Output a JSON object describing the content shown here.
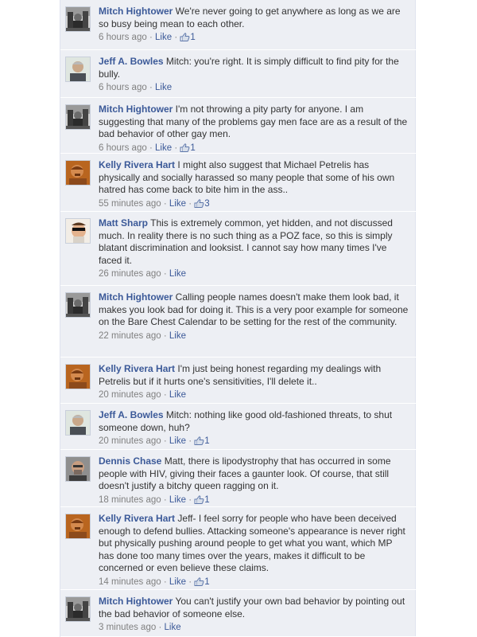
{
  "ui": {
    "like_label": "Like",
    "separator": "·"
  },
  "comments": [
    {
      "author": "Mitch Hightower",
      "avatar": "mitch",
      "text": "We're never going to get anywhere as long as we are so busy being mean to each other.",
      "time": "6 hours ago",
      "likes": "1"
    },
    {
      "author": "Jeff A. Bowles",
      "avatar": "jeff",
      "text": "Mitch: you're right. It is simply difficult to find pity for the bully.",
      "time": "6 hours ago",
      "likes": ""
    },
    {
      "author": "Mitch Hightower",
      "avatar": "mitch",
      "text": "I'm not throwing a pity party for anyone. I am suggesting that many of the problems gay men face are as a result of the bad behavior of other gay men.",
      "time": "6 hours ago",
      "likes": "1"
    },
    {
      "author": "Kelly Rivera Hart",
      "avatar": "kelly",
      "text": "I might also suggest that Michael Petrelis has physically and socially harassed so many people that some of his own hatred has come back to bite him in the ass..",
      "time": "55 minutes ago",
      "likes": "3"
    },
    {
      "author": "Matt Sharp",
      "avatar": "matt",
      "text": "This is extremely common, yet hidden, and not discussed much. In reality there is no such thing as a POZ face, so this is simply blatant discrimination and looksist. I cannot say how many times I've faced it.",
      "time": "26 minutes ago",
      "likes": ""
    },
    {
      "author": "Mitch Hightower",
      "avatar": "mitch",
      "text": "Calling people names doesn't make them look bad, it makes you look bad for doing it. This is a very poor example for someone on the Bare Chest Calendar to be setting for the rest of the community.",
      "time": "22 minutes ago",
      "likes": ""
    },
    {
      "author": "Kelly Rivera Hart",
      "avatar": "kelly",
      "text": "I'm just being honest regarding my dealings with Petrelis but if it hurts one's sensitivities, I'll delete it..",
      "time": "20 minutes ago",
      "likes": ""
    },
    {
      "author": "Jeff A. Bowles",
      "avatar": "jeff",
      "text": "Mitch: nothing like good old-fashioned threats, to shut someone down, huh?",
      "time": "20 minutes ago",
      "likes": "1"
    },
    {
      "author": "Dennis Chase",
      "avatar": "dennis",
      "text": "Matt, there is lipodystrophy that has occurred in some people with HIV, giving their faces a gaunter look. Of course, that still doesn't justify a bitchy queen ragging on it.",
      "time": "18 minutes ago",
      "likes": "1"
    },
    {
      "author": "Kelly Rivera Hart",
      "avatar": "kelly",
      "text": "Jeff- I feel sorry for people who have been deceived enough to defend bullies. Attacking someone's appearance is never right but physically pushing around people to get what you want, which MP has done too many times over the years, makes it difficult to be concerned or even believe these claims.",
      "time": "14 minutes ago",
      "likes": "1"
    },
    {
      "author": "Mitch Hightower",
      "avatar": "mitch",
      "text": "You can't justify your own bad behavior by pointing out the bad behavior of someone else.",
      "time": "3 minutes ago",
      "likes": ""
    }
  ]
}
